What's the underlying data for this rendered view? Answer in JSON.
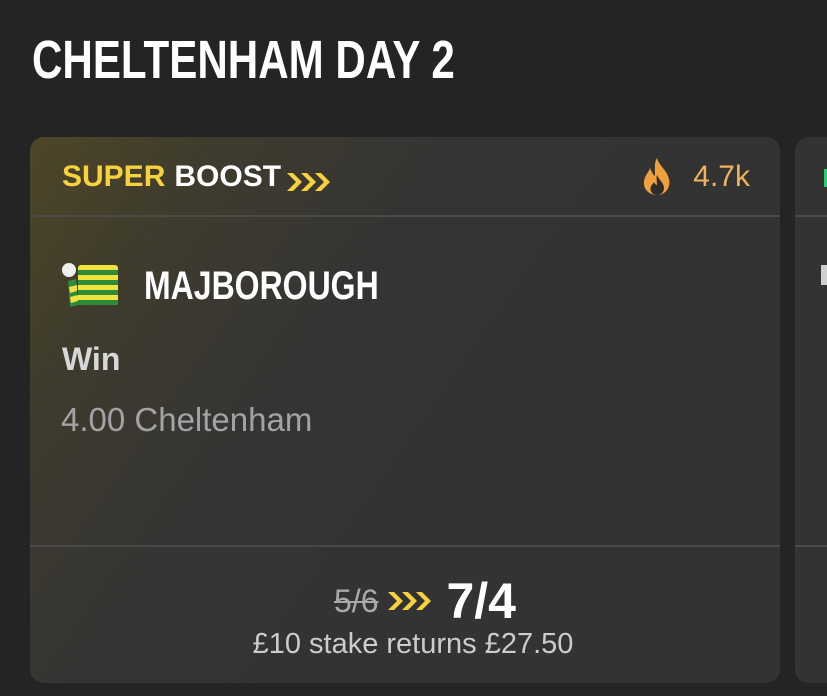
{
  "page": {
    "title": "CHELTENHAM DAY 2"
  },
  "card": {
    "boost_super": "SUPER",
    "boost_word": "BOOST",
    "boost_icon": "triple-chevron-right-icon",
    "popularity_icon": "fire-icon",
    "popularity_count": "4.7k",
    "silks_icon": "jockey-silks-icon",
    "horse_name": "MAJBOROUGH",
    "market": "Win",
    "race": "4.00 Cheltenham",
    "odds_old": "5/6",
    "odds_new": "7/4",
    "returns_text": "£10 stake returns £27.50"
  },
  "colors": {
    "background": "#242424",
    "card": "#333333",
    "boost_yellow": "#f7d23a",
    "popularity_orange": "#f0b25a",
    "silks_green": "#2e8b3a",
    "silks_yellow": "#f2e23c"
  }
}
